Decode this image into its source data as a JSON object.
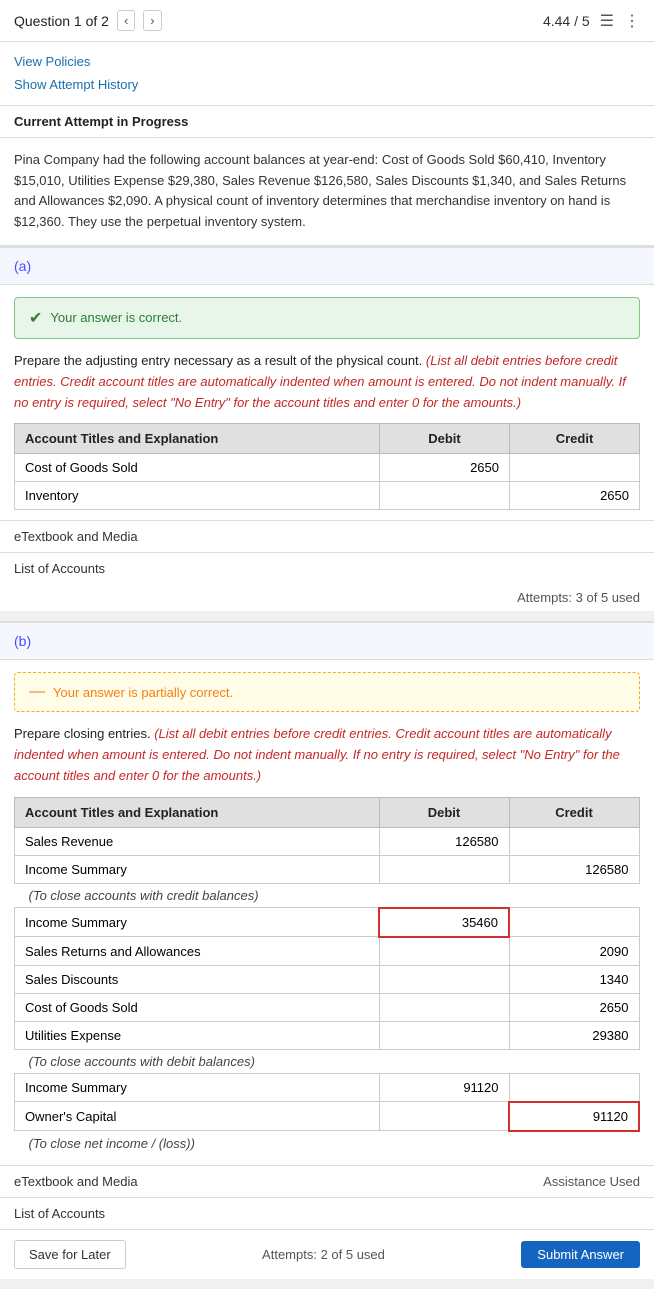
{
  "header": {
    "question_label": "Question 1 of 2",
    "score": "4.44 / 5",
    "prev_icon": "‹",
    "next_icon": "›",
    "list_icon": "☰",
    "menu_icon": "⋮"
  },
  "links": {
    "view_policies": "View Policies",
    "show_attempt_history": "Show Attempt History"
  },
  "current_attempt": "Current Attempt in Progress",
  "problem_text": "Pina Company had the following account balances at year-end: Cost of Goods Sold $60,410, Inventory $15,010, Utilities Expense $29,380, Sales Revenue $126,580, Sales Discounts $1,340, and Sales Returns and Allowances $2,090. A physical count of inventory determines that merchandise inventory on hand is $12,360. They use the perpetual inventory system.",
  "part_a": {
    "label": "(a)",
    "correct_banner": "Your answer is correct.",
    "instruction_plain": "Prepare the adjusting entry necessary as a result of the physical count. ",
    "instruction_italic": "(List all debit entries before credit entries. Credit account titles are automatically indented when amount is entered. Do not indent manually. If no entry is required, select \"No Entry\" for the account titles and enter 0 for the amounts.)",
    "table": {
      "headers": [
        "Account Titles and Explanation",
        "Debit",
        "Credit"
      ],
      "rows": [
        {
          "account": "Cost of Goods Sold",
          "debit": "2650",
          "credit": "",
          "debit_error": false,
          "credit_error": false
        },
        {
          "account": "Inventory",
          "debit": "",
          "credit": "2650",
          "debit_error": false,
          "credit_error": false
        }
      ]
    },
    "etextbook": "eTextbook and Media",
    "list_of_accounts": "List of Accounts",
    "attempts": "Attempts: 3 of 5 used"
  },
  "part_b": {
    "label": "(b)",
    "partial_banner": "Your answer is partially correct.",
    "instruction_plain": "Prepare closing entries. ",
    "instruction_italic": "(List all debit entries before credit entries. Credit account titles are automatically indented when amount is entered. Do not indent manually. If no entry is required, select \"No Entry\" for the account titles and enter 0 for the amounts.)",
    "table": {
      "headers": [
        "Account Titles and Explanation",
        "Debit",
        "Credit"
      ],
      "rows": [
        {
          "account": "Sales Revenue",
          "debit": "126580",
          "credit": "",
          "debit_error": false,
          "credit_error": false
        },
        {
          "account": "Income Summary",
          "debit": "",
          "credit": "126580",
          "debit_error": false,
          "credit_error": false
        },
        {
          "note": "(To close accounts with credit balances)"
        },
        {
          "account": "Income Summary",
          "debit": "35460",
          "credit": "",
          "debit_error": true,
          "credit_error": false
        },
        {
          "account": "Sales Returns and Allowances",
          "debit": "",
          "credit": "2090",
          "debit_error": false,
          "credit_error": false
        },
        {
          "account": "Sales Discounts",
          "debit": "",
          "credit": "1340",
          "debit_error": false,
          "credit_error": false
        },
        {
          "account": "Cost of Goods Sold",
          "debit": "",
          "credit": "2650",
          "debit_error": true,
          "credit_error": false
        },
        {
          "account": "Utilities Expense",
          "debit": "",
          "credit": "29380",
          "debit_error": false,
          "credit_error": false
        },
        {
          "note": "(To close accounts with debit balances)"
        },
        {
          "account": "Income Summary",
          "debit": "91120",
          "credit": "",
          "debit_error": false,
          "credit_error": false
        },
        {
          "account": "Owner's Capital",
          "debit": "",
          "credit": "91120",
          "debit_error": false,
          "credit_error": true
        },
        {
          "note": "(To close net income / (loss))"
        }
      ]
    },
    "etextbook": "eTextbook and Media",
    "assistance": "Assistance Used",
    "list_of_accounts": "List of Accounts",
    "save_label": "Save for Later",
    "submit_label": "Submit Answer",
    "attempts": "Attempts: 2 of 5 used"
  }
}
